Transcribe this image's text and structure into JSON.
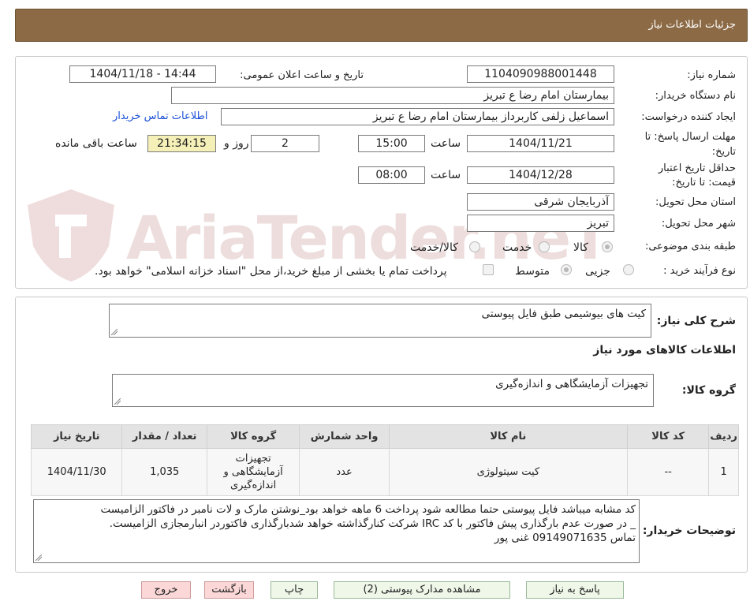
{
  "header": {
    "title": "جزئیات اطلاعات نیاز"
  },
  "form": {
    "need_number_label": "شماره نیاز:",
    "need_number": "1104090988001448",
    "announce_label": "تاریخ و ساعت اعلان عمومی:",
    "announce_value": "1404/11/18 - 14:44",
    "buyer_org_label": "نام دستگاه خریدار:",
    "buyer_org": "بیمارستان امام رضا  ع  تبریز",
    "creator_label": "ایجاد کننده درخواست:",
    "creator": "اسماعیل زلفی کاربرداز بیمارستان امام رضا  ع  تبریز",
    "contact_link": "اطلاعات تماس خریدار",
    "deadline_label_1": "مهلت ارسال پاسخ: تا",
    "deadline_label_2": "تاریخ:",
    "deadline_date": "1404/11/21",
    "time_label": "ساعت",
    "deadline_time": "15:00",
    "days_value": "2",
    "days_label": "روز و",
    "remaining_time": "21:34:15",
    "remaining_label": "ساعت باقی مانده",
    "validity_label_1": "حداقل تاریخ اعتبار",
    "validity_label_2": "قیمت: تا تاریخ:",
    "validity_date": "1404/12/28",
    "validity_time": "08:00",
    "province_label": "استان محل تحویل:",
    "province": "آذربایجان شرقی",
    "city_label": "شهر محل تحویل:",
    "city": "تبریز",
    "category_label": "طبقه بندی موضوعی:",
    "category_options": [
      "کالا",
      "خدمت",
      "کالا/خدمت"
    ],
    "category_selected": "کالا",
    "process_label": "نوع فرآیند خرید :",
    "process_options": [
      "جزیی",
      "متوسط"
    ],
    "process_selected": "متوسط",
    "payment_note": "پرداخت تمام یا بخشی از مبلغ خرید،از محل \"اسناد خزانه اسلامی\" خواهد بود."
  },
  "summary": {
    "desc_label": "شرح کلی نیاز:",
    "desc_value": "کیت های بیوشیمی طبق فایل پیوستی",
    "items_title": "اطلاعات کالاهای مورد نیاز",
    "group_label": "گروه کالا:",
    "group_value": "تجهیزات آزمایشگاهی و اندازه‌گیری"
  },
  "table": {
    "headers": [
      "ردیف",
      "کد کالا",
      "نام کالا",
      "واحد شمارش",
      "گروه کالا",
      "تعداد / مقدار",
      "تاریخ نیاز"
    ],
    "rows": [
      {
        "row": "1",
        "code": "--",
        "name": "کیت سیتولوژی",
        "unit": "عدد",
        "group": "تجهیزات آزمایشگاهی و اندازه‌گیری",
        "qty": "1,035",
        "date": "1404/11/30"
      }
    ]
  },
  "notes": {
    "label": "توضیحات خریدار:",
    "lines": [
      "کد مشابه میباشد فایل پیوستی حتما مطالعه شود  پرداخت 6 ماهه خواهد بود_نوشتن مارک و لات نامبر در فاکتور الزامیست",
      "_  در صورت عدم بارگذاری پیش فاکتور با کد IRC  شرکت کنارگذاشته خواهد شدبارگذاری فاکتوردر انبارمجازی الزامیست.",
      "تماس 09149071635 غنی پور"
    ]
  },
  "buttons": {
    "reply": "پاسخ به نیاز",
    "attachments": "مشاهده مدارک پیوستی (2)",
    "print": "چاپ",
    "back": "بازگشت",
    "exit": "خروج"
  },
  "watermark": {
    "text": "AriaTender.neT"
  }
}
